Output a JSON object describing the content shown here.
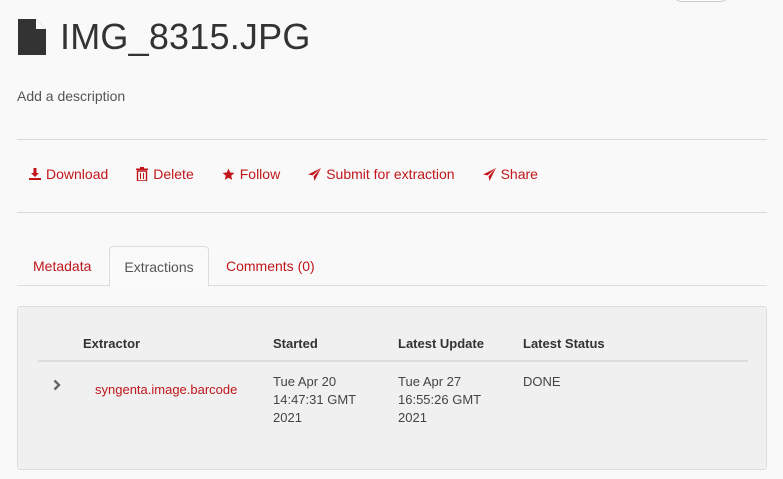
{
  "file": {
    "name": "IMG_8315.JPG",
    "icon": "file-icon",
    "description_placeholder": "Add a description"
  },
  "colors": {
    "accent": "#c0161b",
    "text": "#333333",
    "panel_bg": "#f0f0f0"
  },
  "actions": [
    {
      "label": "Download",
      "icon": "download-icon"
    },
    {
      "label": "Delete",
      "icon": "trash-icon"
    },
    {
      "label": "Follow",
      "icon": "star-icon"
    },
    {
      "label": "Submit for extraction",
      "icon": "send-icon"
    },
    {
      "label": "Share",
      "icon": "send-icon"
    }
  ],
  "tabs": [
    {
      "label": "Metadata",
      "active": false
    },
    {
      "label": "Extractions",
      "active": true
    },
    {
      "label": "Comments (0)",
      "active": false
    }
  ],
  "extractions": {
    "columns": [
      "Extractor",
      "Started",
      "Latest Update",
      "Latest Status"
    ],
    "rows": [
      {
        "extractor": "syngenta.image.barcode",
        "started": "Tue Apr 20 14:47:31 GMT 2021",
        "latest_update": "Tue Apr 27 16:55:26 GMT 2021",
        "status": "DONE"
      }
    ]
  }
}
